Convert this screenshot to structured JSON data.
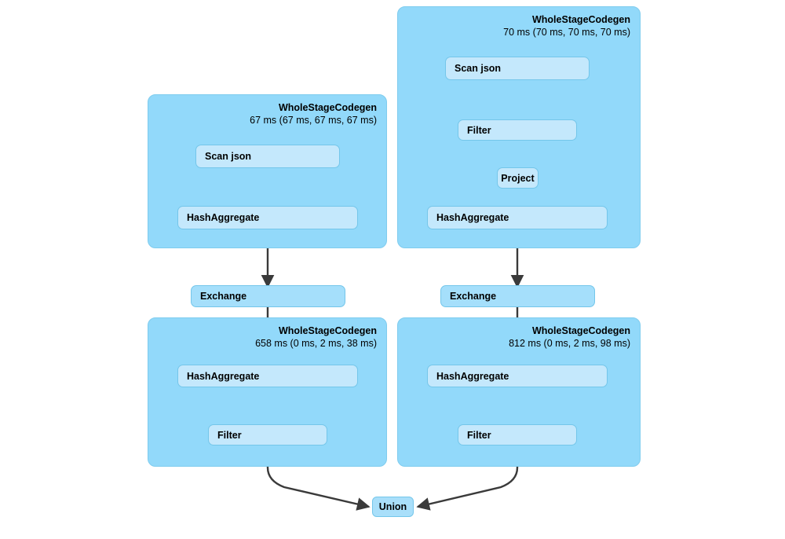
{
  "diagram": {
    "type": "spark-sql-query-execution-plan",
    "background_color": "#ffffff",
    "colors": {
      "cluster_fill": "#92D9FA",
      "cluster_border": "#7FCCEE",
      "node_fill": "#C4E8FC",
      "exchange_fill": "#A5DFFB",
      "union_fill": "#A9DFFA",
      "node_border": "#74C6EA",
      "edge_color": "#3A3A3A"
    }
  },
  "clusters": [
    {
      "id": "cluster-left-top",
      "title": "WholeStageCodegen",
      "metrics": "67 ms (67 ms, 67 ms, 67 ms)",
      "nodes": [
        {
          "id": "left-top-scan",
          "label": "Scan json"
        },
        {
          "id": "left-top-hashagg",
          "label": "HashAggregate"
        }
      ]
    },
    {
      "id": "cluster-right-top",
      "title": "WholeStageCodegen",
      "metrics": "70 ms (70 ms, 70 ms, 70 ms)",
      "nodes": [
        {
          "id": "right-top-scan",
          "label": "Scan json"
        },
        {
          "id": "right-top-filter",
          "label": "Filter"
        },
        {
          "id": "right-top-project",
          "label": "Project"
        },
        {
          "id": "right-top-hashagg",
          "label": "HashAggregate"
        }
      ]
    },
    {
      "id": "cluster-left-bottom",
      "title": "WholeStageCodegen",
      "metrics": "658 ms (0 ms, 2 ms, 38 ms)",
      "nodes": [
        {
          "id": "left-bottom-hashagg",
          "label": "HashAggregate"
        },
        {
          "id": "left-bottom-filter",
          "label": "Filter"
        }
      ]
    },
    {
      "id": "cluster-right-bottom",
      "title": "WholeStageCodegen",
      "metrics": "812 ms (0 ms, 2 ms, 98 ms)",
      "nodes": [
        {
          "id": "right-bottom-hashagg",
          "label": "HashAggregate"
        },
        {
          "id": "right-bottom-filter",
          "label": "Filter"
        }
      ]
    }
  ],
  "standalone_nodes": [
    {
      "id": "left-exchange",
      "label": "Exchange"
    },
    {
      "id": "right-exchange",
      "label": "Exchange"
    },
    {
      "id": "union",
      "label": "Union"
    }
  ],
  "edges": [
    {
      "from": "left-top-scan",
      "to": "left-top-hashagg"
    },
    {
      "from": "left-top-hashagg",
      "to": "left-exchange"
    },
    {
      "from": "left-exchange",
      "to": "left-bottom-hashagg"
    },
    {
      "from": "left-bottom-hashagg",
      "to": "left-bottom-filter"
    },
    {
      "from": "left-bottom-filter",
      "to": "union"
    },
    {
      "from": "right-top-scan",
      "to": "right-top-filter"
    },
    {
      "from": "right-top-filter",
      "to": "right-top-project"
    },
    {
      "from": "right-top-project",
      "to": "right-top-hashagg"
    },
    {
      "from": "right-top-hashagg",
      "to": "right-exchange"
    },
    {
      "from": "right-exchange",
      "to": "right-bottom-hashagg"
    },
    {
      "from": "right-bottom-hashagg",
      "to": "right-bottom-filter"
    },
    {
      "from": "right-bottom-filter",
      "to": "union"
    }
  ]
}
